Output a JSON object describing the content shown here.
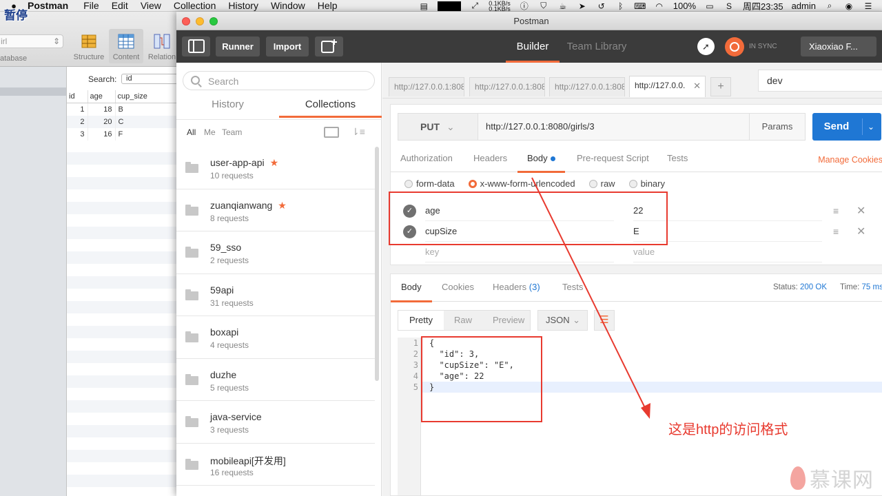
{
  "menubar": {
    "app_name": "Postman",
    "items": [
      "File",
      "Edit",
      "View",
      "Collection",
      "History",
      "Window",
      "Help"
    ],
    "paused_label": "暂停",
    "net_up": "0.1KB/s",
    "net_down": "0.1KB/s",
    "battery": "100%",
    "clock": "周四23:35",
    "user": "admin"
  },
  "bgapp": {
    "db_select": "irl",
    "db_label": "atabase",
    "tools": [
      "Structure",
      "Content",
      "Relation"
    ],
    "search_label": "Search:",
    "search_value": "id",
    "columns": [
      "id",
      "age",
      "cup_size"
    ],
    "rows": [
      [
        "1",
        "18",
        "B"
      ],
      [
        "2",
        "20",
        "C"
      ],
      [
        "3",
        "16",
        "F"
      ]
    ]
  },
  "window": {
    "title": "Postman"
  },
  "header": {
    "runner": "Runner",
    "import": "Import",
    "builder": "Builder",
    "team_library": "Team Library",
    "sync": "IN SYNC",
    "user": "Xiaoxiao F..."
  },
  "sidebar": {
    "search_placeholder": "Search",
    "tabs": [
      "History",
      "Collections"
    ],
    "filters": [
      "All",
      "Me",
      "Team"
    ],
    "collections": [
      {
        "name": "user-app-api",
        "count": "10 requests",
        "starred": true
      },
      {
        "name": "zuanqianwang",
        "count": "8 requests",
        "starred": true
      },
      {
        "name": "59_sso",
        "count": "2 requests",
        "starred": false
      },
      {
        "name": "59api",
        "count": "31 requests",
        "starred": false
      },
      {
        "name": "boxapi",
        "count": "4 requests",
        "starred": false
      },
      {
        "name": "duzhe",
        "count": "5 requests",
        "starred": false
      },
      {
        "name": "java-service",
        "count": "3 requests",
        "starred": false
      },
      {
        "name": "mobileapi[开发用]",
        "count": "16 requests",
        "starred": false
      }
    ]
  },
  "tabs": [
    {
      "label": "http://127.0.0.1:8080"
    },
    {
      "label": "http://127.0.0.1:8080"
    },
    {
      "label": "http://127.0.0.1:808"
    },
    {
      "label": "http://127.0.0."
    }
  ],
  "environment": "dev",
  "request": {
    "method": "PUT",
    "url": "http://127.0.0.1:8080/girls/3",
    "params": "Params",
    "send": "Send",
    "tabs": [
      "Authorization",
      "Headers",
      "Body",
      "Pre-request Script",
      "Tests"
    ],
    "manage_cookies": "Manage Cookies",
    "body_types": [
      "form-data",
      "x-www-form-urlencoded",
      "raw",
      "binary"
    ],
    "selected_body_type": "x-www-form-urlencoded",
    "form": [
      {
        "key": "age",
        "value": "22"
      },
      {
        "key": "cupSize",
        "value": "E"
      }
    ],
    "key_placeholder": "key",
    "value_placeholder": "value"
  },
  "response": {
    "tabs": [
      "Body",
      "Cookies",
      "Headers",
      "Tests"
    ],
    "headers_count": "(3)",
    "status_label": "Status:",
    "status_value": "200 OK",
    "time_label": "Time:",
    "time_value": "75 ms",
    "formats": [
      "Pretty",
      "Raw",
      "Preview"
    ],
    "language": "JSON",
    "line_numbers": [
      "1",
      "2",
      "3",
      "4",
      "5"
    ],
    "lines": [
      "{",
      "  \"id\": 3,",
      "  \"cupSize\": \"E\",",
      "  \"age\": 22",
      "}"
    ]
  },
  "annotation": {
    "text": "这是http的访问格式",
    "color": "#e83a2f"
  },
  "watermark": "慕课网",
  "colors": {
    "accent": "#f26b3a",
    "send": "#1f77d4",
    "header_bg": "#3b3b3b"
  }
}
